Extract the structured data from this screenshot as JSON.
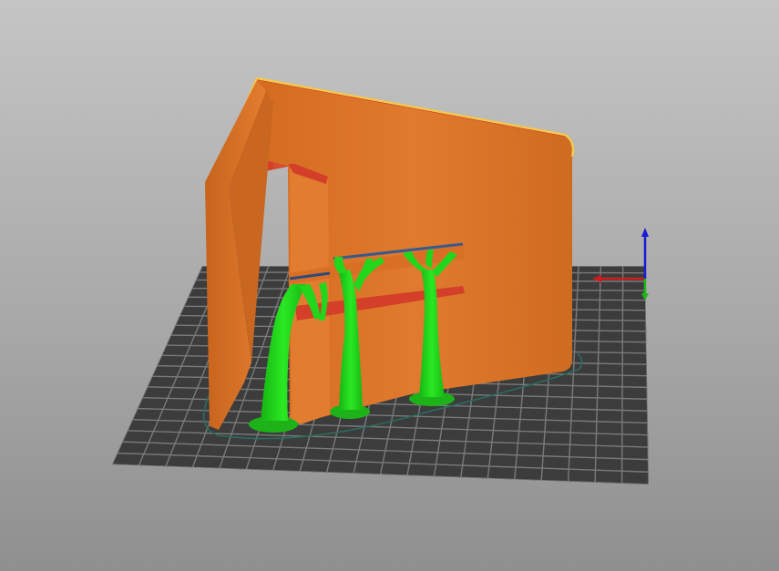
{
  "viewport": {
    "view": "3d-preview",
    "background_top": "#c5c5c5",
    "background_bottom": "#8f8f8f"
  },
  "bed": {
    "grid_color": "#3c3c3c",
    "line_color": "#7a7a7a",
    "grid_cells": 20
  },
  "model": {
    "wall_color": "#e07a2e",
    "top_color": "#d43f2a",
    "edge_color": "#f2c94c"
  },
  "supports": {
    "color": "#22d61c",
    "count": 3
  },
  "skirt": {
    "color": "#2d6b5e"
  },
  "axes": {
    "x_color": "#d41b1b",
    "y_color": "#1bb81b",
    "z_color": "#1b1bd4"
  }
}
